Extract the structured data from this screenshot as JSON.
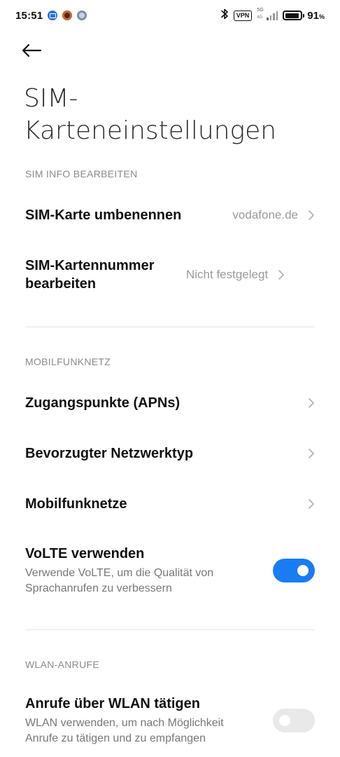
{
  "status_bar": {
    "time": "15:51",
    "vpn": "VPN",
    "network_top": "5G",
    "network_bottom": "4G",
    "battery_percent": "91",
    "battery_unit": "%",
    "battery_level": 0.91,
    "icons": [
      "mail-notification-icon",
      "app-notification-icon",
      "app-notification-icon",
      "bluetooth-icon",
      "vpn-icon",
      "signal-icon",
      "battery-icon"
    ]
  },
  "header": {
    "back_icon": "arrow-left-icon",
    "title": "SIM-Karteneinstellungen"
  },
  "sections": {
    "sim_info": {
      "label": "SIM INFO BEARBEITEN",
      "rename": {
        "title": "SIM-Karte umbenennen",
        "value": "vodafone.de"
      },
      "number": {
        "title": "SIM-Kartennummer bearbeiten",
        "value": "Nicht festgelegt"
      }
    },
    "mobile": {
      "label": "MOBILFUNKNETZ",
      "apn": {
        "title": "Zugangspunkte (APNs)"
      },
      "network_type": {
        "title": "Bevorzugter Netzwerktyp"
      },
      "networks": {
        "title": "Mobilfunknetze"
      },
      "volte": {
        "title": "VoLTE verwenden",
        "subtitle": "Verwende VoLTE, um die Qualität von Sprachanrufen zu verbessern",
        "enabled": true
      }
    },
    "wlan": {
      "label": "WLAN-ANRUFE",
      "wifi_calling": {
        "title": "Anrufe über WLAN tätigen",
        "subtitle": "WLAN verwenden, um nach Möglichkeit Anrufe zu tätigen und zu empfangen",
        "enabled": false
      }
    }
  },
  "colors": {
    "accent": "#1a7cf2",
    "toggle_off": "#e9e9e9",
    "section_label": "#8a8a8a",
    "value_text": "#9a9a9a"
  }
}
